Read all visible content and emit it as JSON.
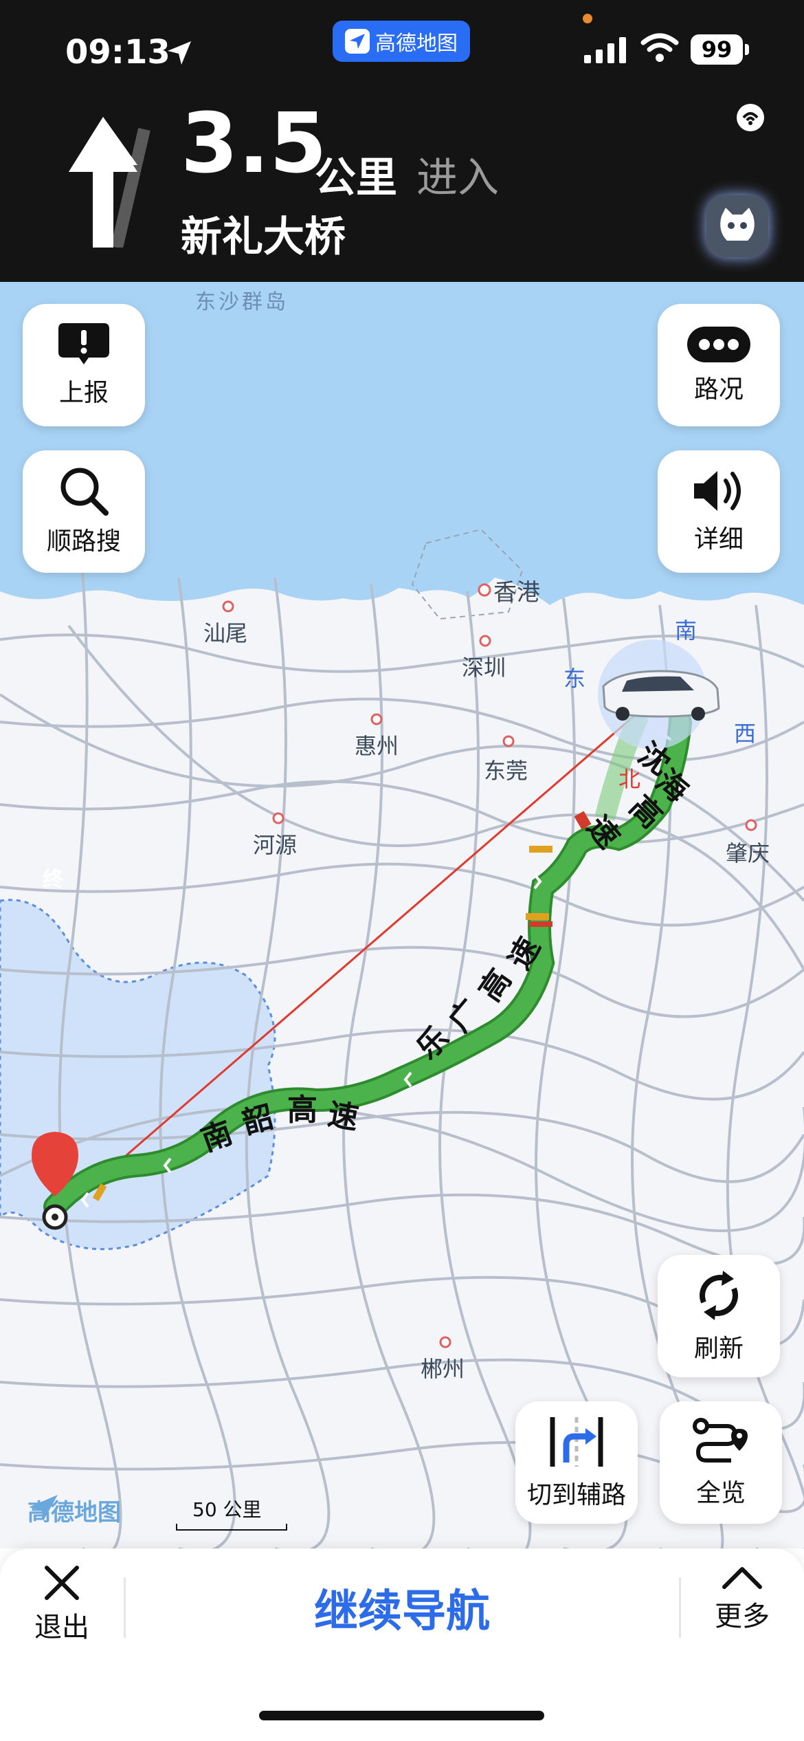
{
  "status_bar": {
    "time": "09:13",
    "battery": "99"
  },
  "app_pill": {
    "label": "高德地图"
  },
  "navigation": {
    "distance_value": "3.5",
    "distance_unit": "公里",
    "action": "进入",
    "road_name": "新礼大桥"
  },
  "map": {
    "place_labels": {
      "dongsha": "东沙群岛",
      "xianggang": "香港",
      "shanwei": "汕尾",
      "shenzhen": "深圳",
      "huizhou": "惠州",
      "dongguan": "东莞",
      "heyuan": "河源",
      "zhaoqing": "肇庆",
      "chenzhou": "郴州"
    },
    "compass": {
      "south": "南",
      "east": "东",
      "north": "北",
      "west": "西"
    },
    "highways": {
      "shenhai": [
        "沈",
        "海",
        "高",
        "速"
      ],
      "leguang": [
        "乐",
        "广",
        "高",
        "速"
      ],
      "nanshao": [
        "南",
        "韶",
        "高",
        "速"
      ]
    },
    "destination_marker": "终",
    "logo_text": "高德地图",
    "scale_text": "50 公里",
    "colors": {
      "route": "#4cb34c",
      "route_outline": "#2e8c2e",
      "straight_line": "#e03a2f",
      "sea": "#a9d3f5",
      "land": "#f4f5f8",
      "province_tint": "#cfe2fa"
    }
  },
  "buttons": {
    "report": "上报",
    "traffic": "路况",
    "search_along": "顺路搜",
    "detail": "详细",
    "refresh": "刷新",
    "switch_side_road": "切到辅路",
    "overview": "全览"
  },
  "bottom_bar": {
    "exit": "退出",
    "continue": "继续导航",
    "more": "更多"
  }
}
